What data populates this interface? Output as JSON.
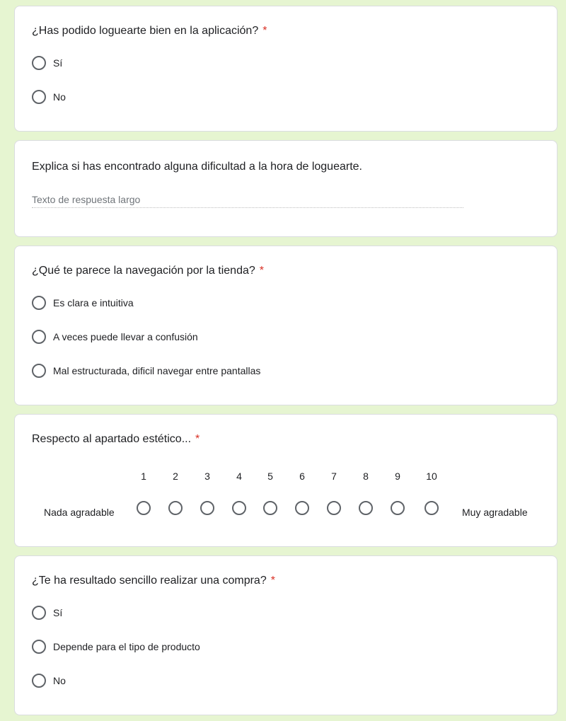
{
  "required_mark": "*",
  "questions": [
    {
      "title": "¿Has podido loguearte bien en la aplicación?",
      "options": [
        "Sí",
        "No"
      ]
    },
    {
      "title": "Explica si has encontrado alguna dificultad a la hora de loguearte.",
      "placeholder": "Texto de respuesta largo"
    },
    {
      "title": "¿Qué te parece la navegación por la tienda?",
      "options": [
        "Es clara e intuitiva",
        "A veces puede llevar a confusión",
        "Mal estructurada, dificil navegar entre pantallas"
      ]
    },
    {
      "title": "Respecto al apartado estético...",
      "scale": [
        "1",
        "2",
        "3",
        "4",
        "5",
        "6",
        "7",
        "8",
        "9",
        "10"
      ],
      "min_label": "Nada agradable",
      "max_label": "Muy agradable"
    },
    {
      "title": "¿Te ha resultado sencillo realizar una compra?",
      "options": [
        "Sí",
        "Depende para el tipo de producto",
        "No"
      ]
    }
  ]
}
